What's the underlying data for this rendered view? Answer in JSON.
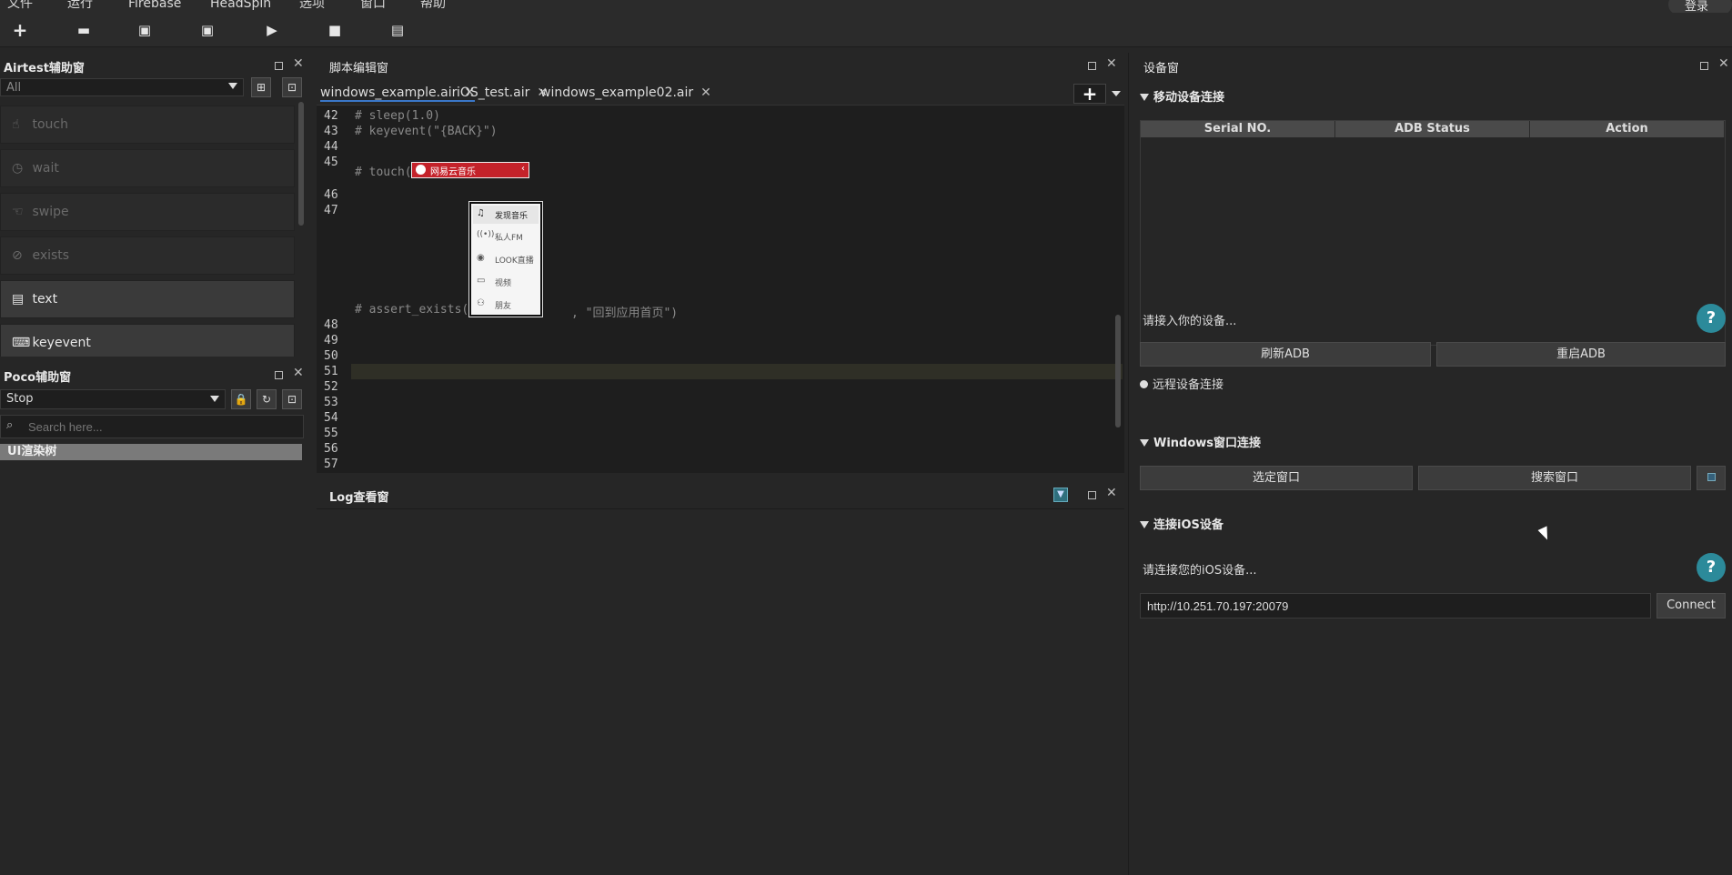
{
  "menu": [
    "文件",
    "运行",
    "Firebase",
    "HeadSpin",
    "选项",
    "窗口",
    "帮助"
  ],
  "login": "登录",
  "toolbar_icons": [
    "new-icon",
    "open-icon",
    "save-icon",
    "save-as-icon",
    "run-icon",
    "stop-icon",
    "log-icon"
  ],
  "airtest": {
    "title": "Airtest辅助窗",
    "filter": "All",
    "items": [
      {
        "label": "touch",
        "icon": "touch-icon",
        "enabled": false
      },
      {
        "label": "wait",
        "icon": "clock-icon",
        "enabled": false
      },
      {
        "label": "swipe",
        "icon": "swipe-icon",
        "enabled": false
      },
      {
        "label": "exists",
        "icon": "check-circle-icon",
        "enabled": false
      },
      {
        "label": "text",
        "icon": "text-icon",
        "enabled": true
      },
      {
        "label": "keyevent",
        "icon": "keyboard-icon",
        "enabled": true
      }
    ]
  },
  "poco": {
    "title": "Poco辅助窗",
    "mode": "Stop",
    "search_placeholder": "Search here...",
    "tree_root": "UI渲染树"
  },
  "editor": {
    "title": "脚本编辑窗",
    "tabs": [
      {
        "label": "windows_example.air",
        "active": true
      },
      {
        "label": "iOS_test.air",
        "active": false
      },
      {
        "label": "windows_example02.air",
        "active": false
      }
    ],
    "lines": [
      {
        "n": "42",
        "code": "# sleep(1.0)"
      },
      {
        "n": "43",
        "code": "# keyevent(\"{BACK}\")"
      },
      {
        "n": "44",
        "code": ""
      },
      {
        "n": "45",
        "code": "# touch("
      },
      {
        "n": "46",
        "code": ""
      },
      {
        "n": "47",
        "code": ""
      },
      {
        "n": "48",
        "code": ""
      },
      {
        "n": "49",
        "code": ""
      },
      {
        "n": "50",
        "code": ""
      },
      {
        "n": "51",
        "code": ""
      },
      {
        "n": "52",
        "code": ""
      },
      {
        "n": "53",
        "code": ""
      },
      {
        "n": "54",
        "code": ""
      },
      {
        "n": "55",
        "code": ""
      },
      {
        "n": "56",
        "code": ""
      },
      {
        "n": "57",
        "code": ""
      }
    ],
    "assert_line": "# assert_exists(",
    "assert_tail": ", \"回到应用首页\")",
    "touch_tail": ")",
    "image_banner": "网易云音乐",
    "image_menu": [
      "发现音乐",
      "私人FM",
      "LOOK直播",
      "视频",
      "朋友"
    ]
  },
  "log": {
    "title": "Log查看窗"
  },
  "device": {
    "title": "设备窗",
    "mobile_section": "移动设备连接",
    "columns": [
      "Serial NO.",
      "ADB Status",
      "Action"
    ],
    "connect_hint": "请接入你的设备...",
    "refresh_adb": "刷新ADB",
    "restart_adb": "重启ADB",
    "remote_connect": "远程设备连接",
    "windows_section": "Windows窗口连接",
    "select_window": "选定窗口",
    "search_window": "搜索窗口",
    "ios_section": "连接iOS设备",
    "ios_hint": "请连接您的iOS设备...",
    "ios_url": "http://10.251.70.197:20079",
    "connect": "Connect",
    "accent": "#2c8a9a"
  }
}
